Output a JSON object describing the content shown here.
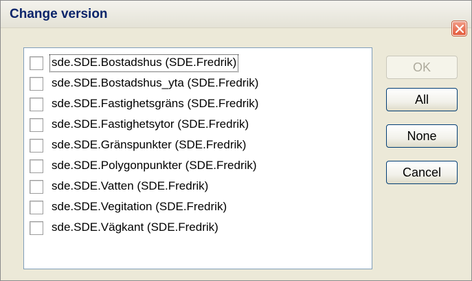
{
  "dialog": {
    "title": "Change version",
    "close_icon": "close-icon",
    "accent": "#e35a3a"
  },
  "list": {
    "items": [
      {
        "label": "sde.SDE.Bostadshus (SDE.Fredrik)",
        "checked": false,
        "focused": true
      },
      {
        "label": "sde.SDE.Bostadshus_yta (SDE.Fredrik)",
        "checked": false
      },
      {
        "label": "sde.SDE.Fastighetsgräns (SDE.Fredrik)",
        "checked": false
      },
      {
        "label": "sde.SDE.Fastighetsytor (SDE.Fredrik)",
        "checked": false
      },
      {
        "label": "sde.SDE.Gränspunkter (SDE.Fredrik)",
        "checked": false
      },
      {
        "label": "sde.SDE.Polygonpunkter (SDE.Fredrik)",
        "checked": false
      },
      {
        "label": "sde.SDE.Vatten (SDE.Fredrik)",
        "checked": false
      },
      {
        "label": "sde.SDE.Vegitation (SDE.Fredrik)",
        "checked": false
      },
      {
        "label": "sde.SDE.Vägkant (SDE.Fredrik)",
        "checked": false
      }
    ]
  },
  "buttons": {
    "ok_label": "OK",
    "ok_enabled": false,
    "all_label": "All",
    "none_label": "None",
    "cancel_label": "Cancel"
  }
}
